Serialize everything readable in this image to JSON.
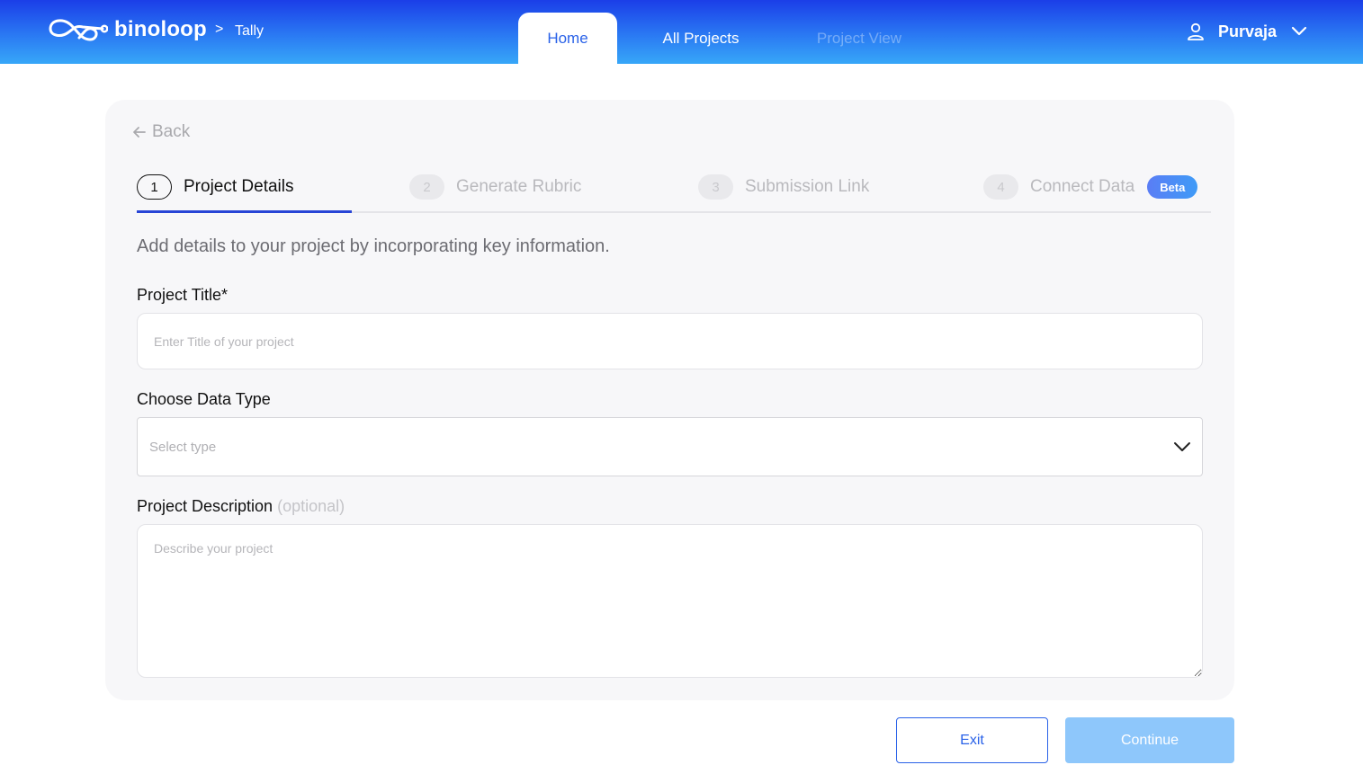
{
  "header": {
    "brand": "binoloop",
    "breadcrumb_sep": ">",
    "breadcrumb": "Tally",
    "tabs": [
      {
        "label": "Home",
        "active": true
      },
      {
        "label": "All Projects",
        "active": false
      },
      {
        "label": "Project View",
        "active": false,
        "disabled": true
      }
    ],
    "user": {
      "name": "Purvaja",
      "icon": "user-icon",
      "menu_icon": "chevron-down-icon"
    }
  },
  "card": {
    "back_label": "Back",
    "steps": [
      {
        "num": "1",
        "label": "Project Details",
        "active": true
      },
      {
        "num": "2",
        "label": "Generate Rubric",
        "active": false
      },
      {
        "num": "3",
        "label": "Submission Link",
        "active": false
      },
      {
        "num": "4",
        "label": "Connect Data",
        "active": false,
        "badge": "Beta"
      }
    ],
    "intro": "Add details to your project by incorporating key information.",
    "fields": {
      "title": {
        "label": "Project Title*",
        "placeholder": "Enter Title of your project",
        "value": ""
      },
      "data_type": {
        "label": "Choose Data Type",
        "placeholder": "Select type",
        "value": ""
      },
      "description": {
        "label": "Project Description",
        "optional": "(optional)",
        "placeholder": "Describe your project",
        "value": ""
      }
    }
  },
  "footer": {
    "exit_label": "Exit",
    "continue_label": "Continue"
  },
  "colors": {
    "header_gradient_start": "#1b3ee8",
    "header_gradient_end": "#37a7f8",
    "accent": "#2a62e8",
    "step_underline": "#2845d6",
    "continue_disabled": "#8ec7fb"
  }
}
